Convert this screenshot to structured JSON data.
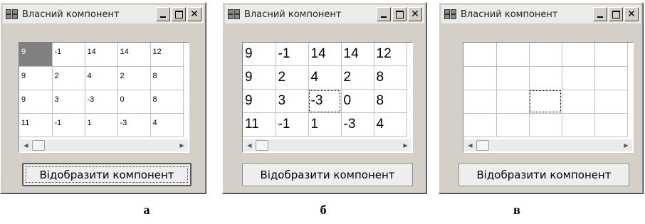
{
  "windows": [
    {
      "title": "Власний компонент",
      "button_label": "Відобразити компонент",
      "caption": "а",
      "grid": [
        [
          "9",
          "-1",
          "14",
          "14",
          "12"
        ],
        [
          "9",
          "2",
          "4",
          "2",
          "8"
        ],
        [
          "9",
          "3",
          "-3",
          "0",
          "8"
        ],
        [
          "11",
          "-1",
          "1",
          "-3",
          "4"
        ]
      ],
      "selected_cell": "0,0",
      "focused_cell": "",
      "large_font": false,
      "default_button": true
    },
    {
      "title": "Власний компонент",
      "button_label": "Відобразити компонент",
      "caption": "б",
      "grid": [
        [
          "9",
          "-1",
          "14",
          "14",
          "12"
        ],
        [
          "9",
          "2",
          "4",
          "2",
          "8"
        ],
        [
          "9",
          "3",
          "-3",
          "0",
          "8"
        ],
        [
          "11",
          "-1",
          "1",
          "-3",
          "4"
        ]
      ],
      "selected_cell": "",
      "focused_cell": "2,2",
      "large_font": true,
      "default_button": false
    },
    {
      "title": "Власний компонент",
      "button_label": "Відобразити компонент",
      "caption": "в",
      "grid": [
        [
          "",
          "",
          "",
          "",
          ""
        ],
        [
          "",
          "",
          "",
          "",
          ""
        ],
        [
          "",
          "",
          "",
          "",
          ""
        ],
        [
          "",
          "",
          "",
          "",
          ""
        ]
      ],
      "selected_cell": "",
      "focused_cell": "2,2",
      "large_font": false,
      "default_button": false
    }
  ],
  "icons": {
    "app": "app-icon",
    "minimize": "minimize-icon",
    "maximize": "maximize-icon",
    "close": "close-icon",
    "scroll_left": "scroll-left-arrow-icon",
    "scroll_right": "scroll-right-arrow-icon"
  }
}
